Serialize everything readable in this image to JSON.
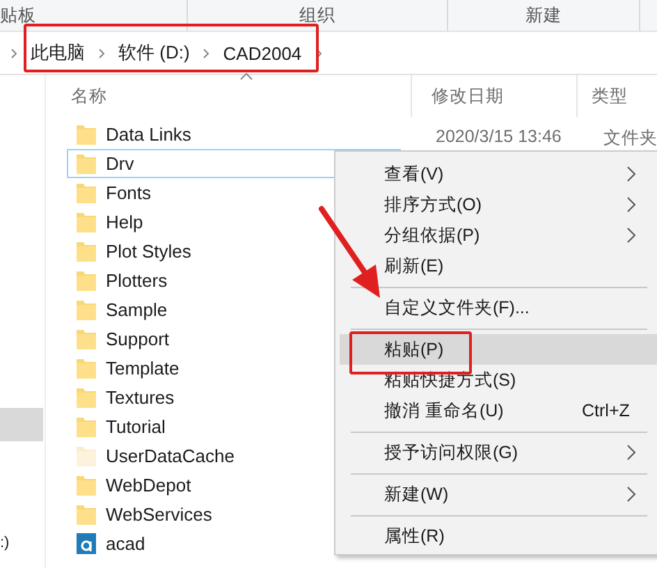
{
  "ribbon": {
    "groups": [
      "贴板",
      "组织",
      "新建"
    ]
  },
  "address_bar": {
    "crumbs": [
      "此电脑",
      "软件 (D:)",
      "CAD2004"
    ]
  },
  "nav_pane": {
    "items": [
      {
        "label": ":)"
      }
    ]
  },
  "columns": [
    "名称",
    "修改日期",
    "类型"
  ],
  "files": [
    {
      "name": "Data Links",
      "kind": "folder",
      "focused": false,
      "date": "2020/3/15 13:46",
      "type": "文件夹"
    },
    {
      "name": "Drv",
      "kind": "folder",
      "focused": true
    },
    {
      "name": "Fonts",
      "kind": "folder",
      "focused": false
    },
    {
      "name": "Help",
      "kind": "folder",
      "focused": false
    },
    {
      "name": "Plot Styles",
      "kind": "folder",
      "focused": false
    },
    {
      "name": "Plotters",
      "kind": "folder",
      "focused": false
    },
    {
      "name": "Sample",
      "kind": "folder",
      "focused": false
    },
    {
      "name": "Support",
      "kind": "folder",
      "focused": false
    },
    {
      "name": "Template",
      "kind": "folder",
      "focused": false
    },
    {
      "name": "Textures",
      "kind": "folder",
      "focused": false
    },
    {
      "name": "Tutorial",
      "kind": "folder",
      "focused": false
    },
    {
      "name": "UserDataCache",
      "kind": "hidden_folder",
      "focused": false
    },
    {
      "name": "WebDepot",
      "kind": "folder",
      "focused": false
    },
    {
      "name": "WebServices",
      "kind": "folder",
      "focused": false
    },
    {
      "name": "acad",
      "kind": "app",
      "focused": false
    }
  ],
  "context_menu": {
    "items": [
      {
        "kind": "item",
        "label": "查看(V)",
        "submenu": true,
        "selected": false
      },
      {
        "kind": "item",
        "label": "排序方式(O)",
        "submenu": true,
        "selected": false
      },
      {
        "kind": "item",
        "label": "分组依据(P)",
        "submenu": true,
        "selected": false
      },
      {
        "kind": "item",
        "label": "刷新(E)",
        "submenu": false,
        "selected": false
      },
      {
        "kind": "separator"
      },
      {
        "kind": "item",
        "label": "自定义文件夹(F)...",
        "submenu": false,
        "selected": false
      },
      {
        "kind": "separator"
      },
      {
        "kind": "item",
        "label": "粘贴(P)",
        "submenu": false,
        "selected": true
      },
      {
        "kind": "item",
        "label": "粘贴快捷方式(S)",
        "submenu": false,
        "selected": false
      },
      {
        "kind": "item",
        "label": "撤消 重命名(U)",
        "submenu": false,
        "selected": false,
        "shortcut": "Ctrl+Z"
      },
      {
        "kind": "separator"
      },
      {
        "kind": "item",
        "label": "授予访问权限(G)",
        "submenu": true,
        "selected": false
      },
      {
        "kind": "separator"
      },
      {
        "kind": "item",
        "label": "新建(W)",
        "submenu": true,
        "selected": false
      },
      {
        "kind": "separator"
      },
      {
        "kind": "item",
        "label": "属性(R)",
        "submenu": false,
        "selected": false
      }
    ]
  }
}
